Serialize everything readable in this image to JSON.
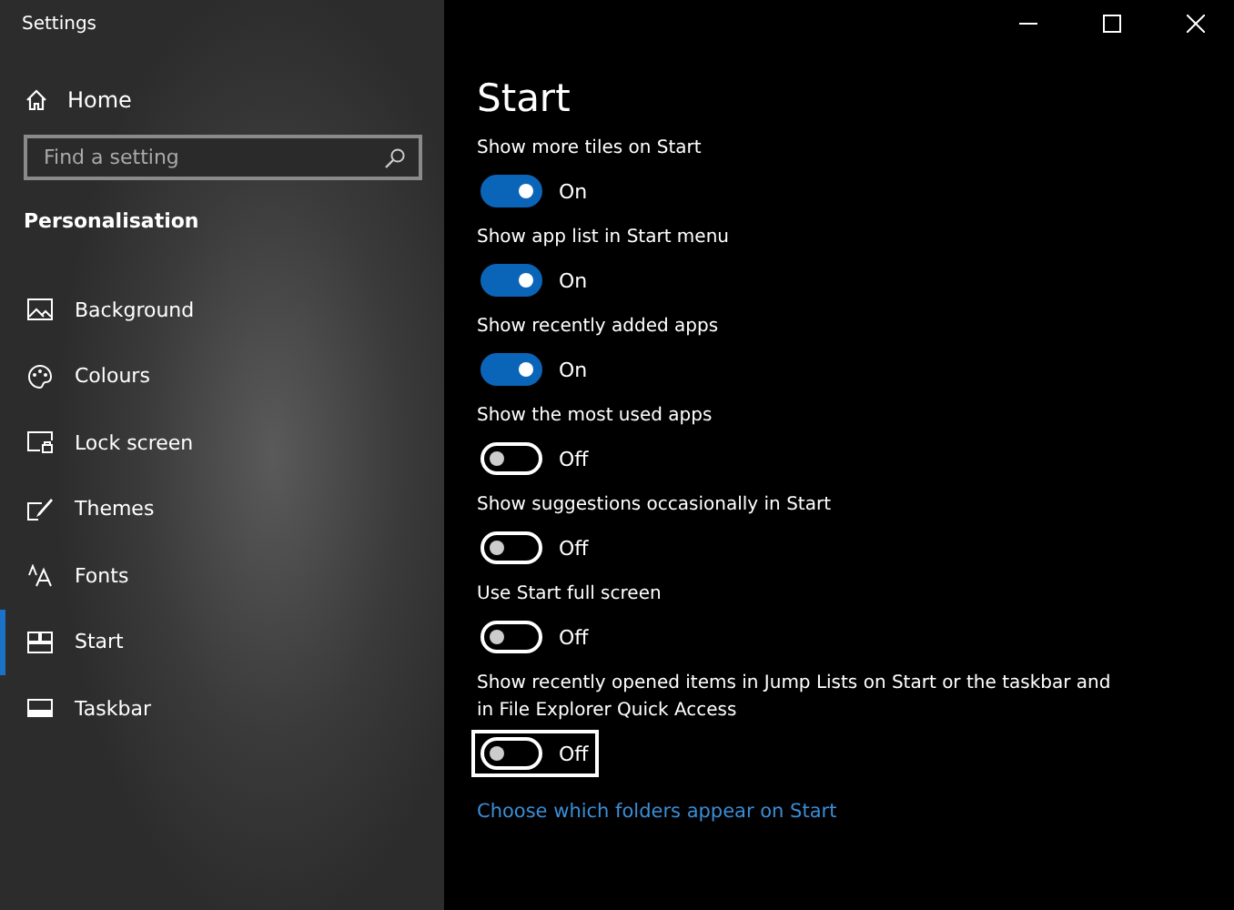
{
  "window": {
    "title": "Settings"
  },
  "sidebar": {
    "home": "Home",
    "search": {
      "placeholder": "Find a setting"
    },
    "section": "Personalisation",
    "items": [
      {
        "label": "Background",
        "kind": "background",
        "selected": false
      },
      {
        "label": "Colours",
        "kind": "colours",
        "selected": false
      },
      {
        "label": "Lock screen",
        "kind": "lock",
        "selected": false
      },
      {
        "label": "Themes",
        "kind": "themes",
        "selected": false
      },
      {
        "label": "Fonts",
        "kind": "fonts",
        "selected": false
      },
      {
        "label": "Start",
        "kind": "start",
        "selected": true
      },
      {
        "label": "Taskbar",
        "kind": "taskbar",
        "selected": false
      }
    ]
  },
  "page": {
    "title": "Start",
    "settings": [
      {
        "label": "Show more tiles on Start",
        "on": true,
        "state": "On",
        "focused": false
      },
      {
        "label": "Show app list in Start menu",
        "on": true,
        "state": "On",
        "focused": false
      },
      {
        "label": "Show recently added apps",
        "on": true,
        "state": "On",
        "focused": false
      },
      {
        "label": "Show the most used apps",
        "on": false,
        "state": "Off",
        "focused": false
      },
      {
        "label": "Show suggestions occasionally in Start",
        "on": false,
        "state": "Off",
        "focused": false
      },
      {
        "label": "Use Start full screen",
        "on": false,
        "state": "Off",
        "focused": false
      },
      {
        "label": "Show recently opened items in Jump Lists on Start or the taskbar and in File Explorer Quick Access",
        "on": false,
        "state": "Off",
        "focused": true
      }
    ],
    "link": "Choose which folders appear on Start"
  }
}
